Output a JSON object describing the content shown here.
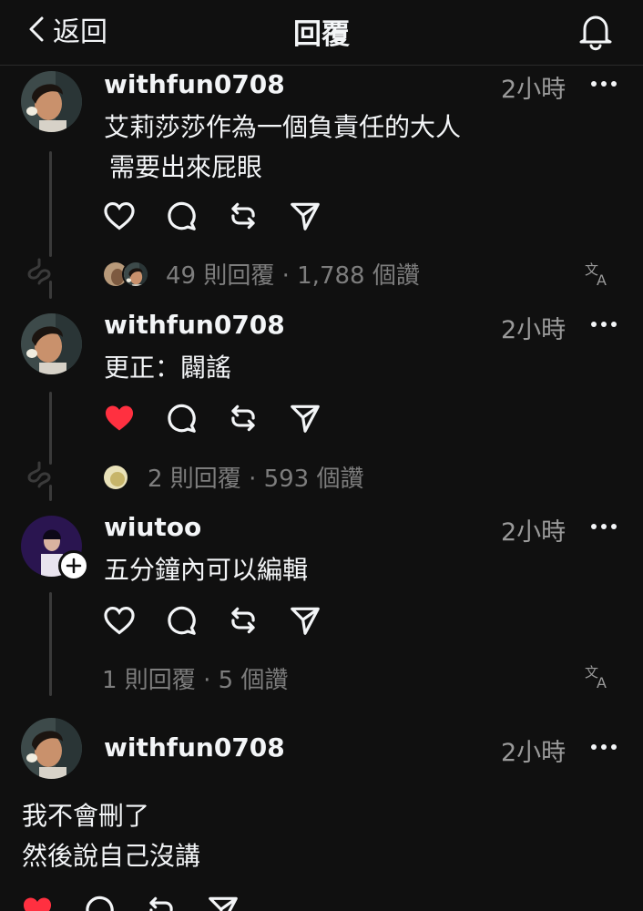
{
  "header": {
    "back_label": "返回",
    "title": "回覆"
  },
  "posts": [
    {
      "username": "withfun0708",
      "time": "2小時",
      "lines": [
        "艾莉莎莎作為一個負責任的大人",
        "需要出來屁眼"
      ],
      "liked": false,
      "stats": "49 則回覆 · 1,788 個讚",
      "has_translate": true
    },
    {
      "username": "withfun0708",
      "time": "2小時",
      "lines": [
        "更正：闢謠"
      ],
      "liked": true,
      "stats": "2 則回覆 · 593 個讚",
      "has_translate": false
    },
    {
      "username": "wiutoo",
      "time": "2小時",
      "lines": [
        "五分鐘內可以編輯"
      ],
      "liked": false,
      "stats": "1 則回覆 · 5 個讚",
      "has_translate": true
    },
    {
      "username": "withfun0708",
      "time": "2小時",
      "lines": [
        "我不會刪了",
        "然後說自己沒講"
      ],
      "liked": true
    }
  ],
  "colors": {
    "background": "#101010",
    "text": "#f3f5f7",
    "muted": "#7d7d7d",
    "like_red": "#ff3040"
  },
  "icons": [
    "chevron-left-icon",
    "bell-icon",
    "more-icon",
    "heart-icon",
    "comment-icon",
    "repost-icon",
    "share-icon",
    "translate-icon",
    "thread-loop-icon",
    "follow-plus-icon"
  ]
}
